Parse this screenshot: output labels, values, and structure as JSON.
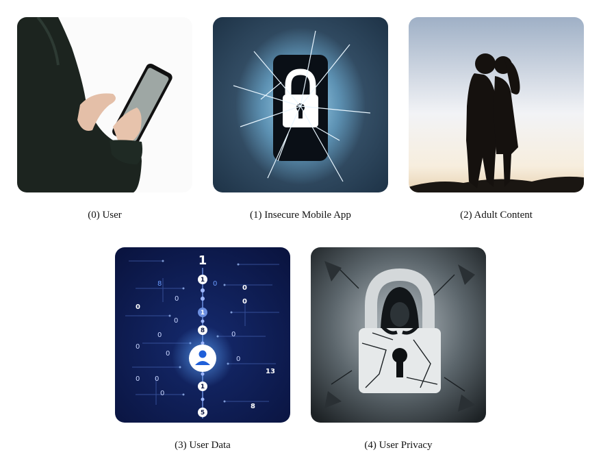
{
  "panels": [
    {
      "caption": "(0) User",
      "icon": "person-holding-phone-icon"
    },
    {
      "caption": "(1) Insecure Mobile App",
      "icon": "cracked-phone-lock-icon"
    },
    {
      "caption": "(2) Adult Content",
      "icon": "couple-silhouette-icon"
    },
    {
      "caption": "(3) User Data",
      "icon": "binary-data-stream-icon"
    },
    {
      "caption": "(4) User Privacy",
      "icon": "hooded-figure-broken-lock-icon"
    }
  ],
  "data_stream": {
    "top_digit": "1",
    "chain": [
      "1",
      "1",
      "8",
      "1",
      "5"
    ],
    "scatter": [
      "8",
      "0",
      "0",
      "0",
      "0",
      "0",
      "0",
      "0",
      "0",
      "0",
      "0",
      "0",
      "0",
      "0",
      "0",
      "13",
      "8"
    ]
  }
}
